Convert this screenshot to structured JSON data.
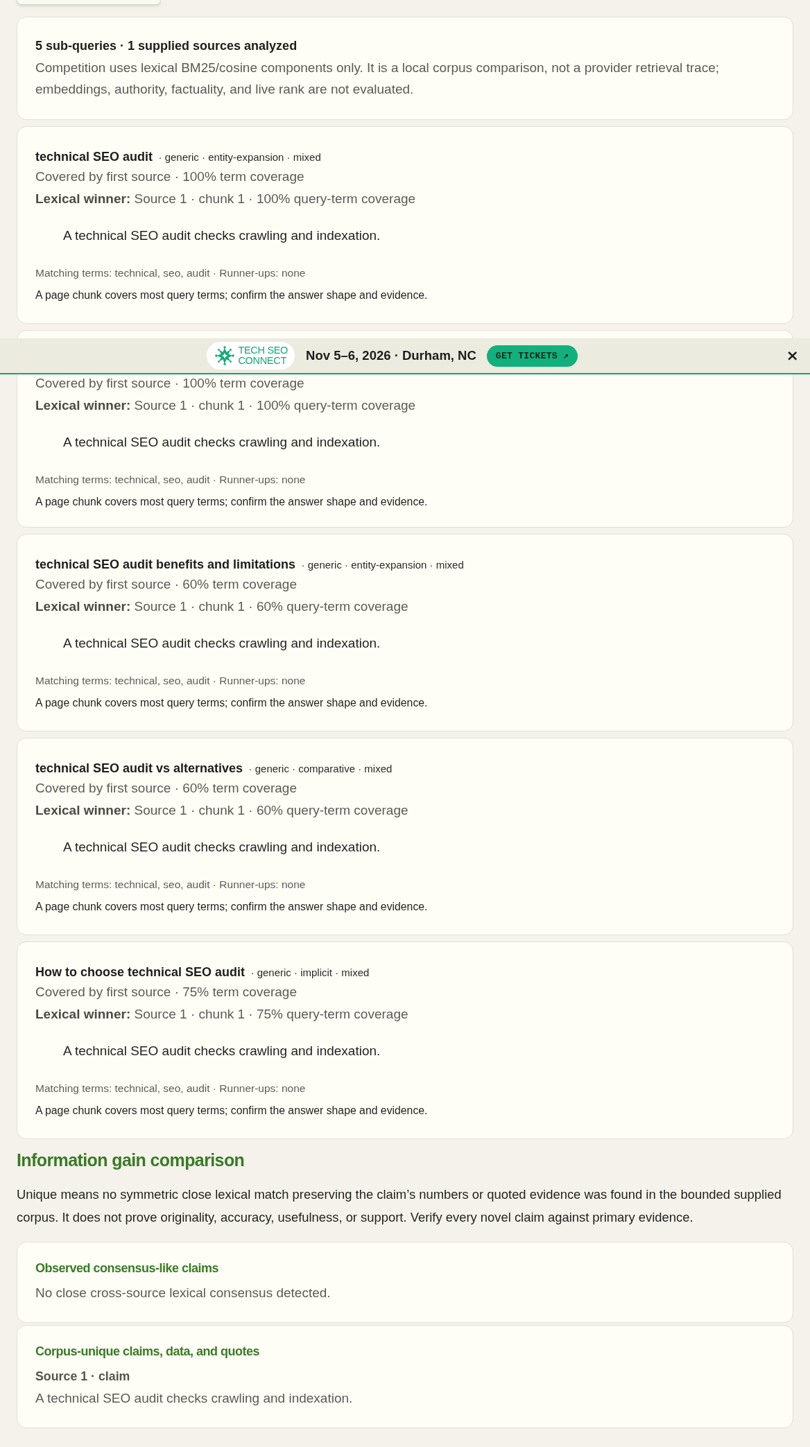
{
  "summary": {
    "title": "5 sub-queries · 1 supplied sources analyzed",
    "text": "Competition uses lexical BM25/cosine components only. It is a local corpus comparison, not a provider retrieval trace; embeddings, authority, factuality, and live rank are not evaluated."
  },
  "subqueries": [
    {
      "query": "technical SEO audit",
      "tags": "· generic · entity-expansion · mixed",
      "coverage": "Covered by first source · 100% term coverage",
      "winner": "**Lexical winner:** Source 1 · chunk 1 · 100% query-term coverage",
      "quote": "A technical SEO audit checks crawling and indexation.",
      "terms": "Matching terms: technical, seo, audit · Runner-ups: none",
      "note": "A page chunk covers most query terms; confirm the answer shape and evidence."
    },
    {
      "coverage": "Covered by first source · 100% term coverage",
      "winner": "**Lexical winner:** Source 1 · chunk 1 · 100% query-term coverage",
      "quote": "A technical SEO audit checks crawling and indexation.",
      "terms": "Matching terms: technical, seo, audit · Runner-ups: none",
      "note": "A page chunk covers most query terms; confirm the answer shape and evidence."
    },
    {
      "query": "technical SEO audit benefits and limitations",
      "tags": "· generic · entity-expansion · mixed",
      "coverage": "Covered by first source · 60% term coverage",
      "winner": "**Lexical winner:** Source 1 · chunk 1 · 60% query-term coverage",
      "quote": "A technical SEO audit checks crawling and indexation.",
      "terms": "Matching terms: technical, seo, audit · Runner-ups: none",
      "note": "A page chunk covers most query terms; confirm the answer shape and evidence."
    },
    {
      "query": "technical SEO audit vs alternatives",
      "tags": "· generic · comparative · mixed",
      "coverage": "Covered by first source · 60% term coverage",
      "winner": "**Lexical winner:** Source 1 · chunk 1 · 60% query-term coverage",
      "quote": "A technical SEO audit checks crawling and indexation.",
      "terms": "Matching terms: technical, seo, audit · Runner-ups: none",
      "note": "A page chunk covers most query terms; confirm the answer shape and evidence."
    },
    {
      "query": "How to choose technical SEO audit",
      "tags": "· generic · implicit · mixed",
      "coverage": "Covered by first source · 75% term coverage",
      "winner": "**Lexical winner:** Source 1 · chunk 1 · 75% query-term coverage",
      "quote": "A technical SEO audit checks crawling and indexation.",
      "terms": "Matching terms: technical, seo, audit · Runner-ups: none",
      "note": "A page chunk covers most query terms; confirm the answer shape and evidence."
    }
  ],
  "banner": {
    "logo": [
      "TECH SEO",
      "CONNECT"
    ],
    "event": "Nov 5–6, 2026 · Durham, NC",
    "button": "GET TICKETS ↗",
    "close": "×"
  },
  "information_gain": {
    "heading": "Information gain comparison",
    "text": "Unique means no symmetric close lexical match preserving the claim’s numbers or quoted evidence was found in the bounded supplied corpus. It does not prove originality, accuracy, usefulness, or support. Verify every novel claim against primary evidence.",
    "panels": [
      {
        "title": "Observed consensus-like claims",
        "text": "No close cross-source lexical consensus detected."
      },
      {
        "title": "Corpus-unique claims, data, and quotes",
        "items": [
          {
            "label": "Source 1 · claim",
            "text": "A technical SEO audit checks crawling and indexation."
          }
        ]
      }
    ]
  }
}
